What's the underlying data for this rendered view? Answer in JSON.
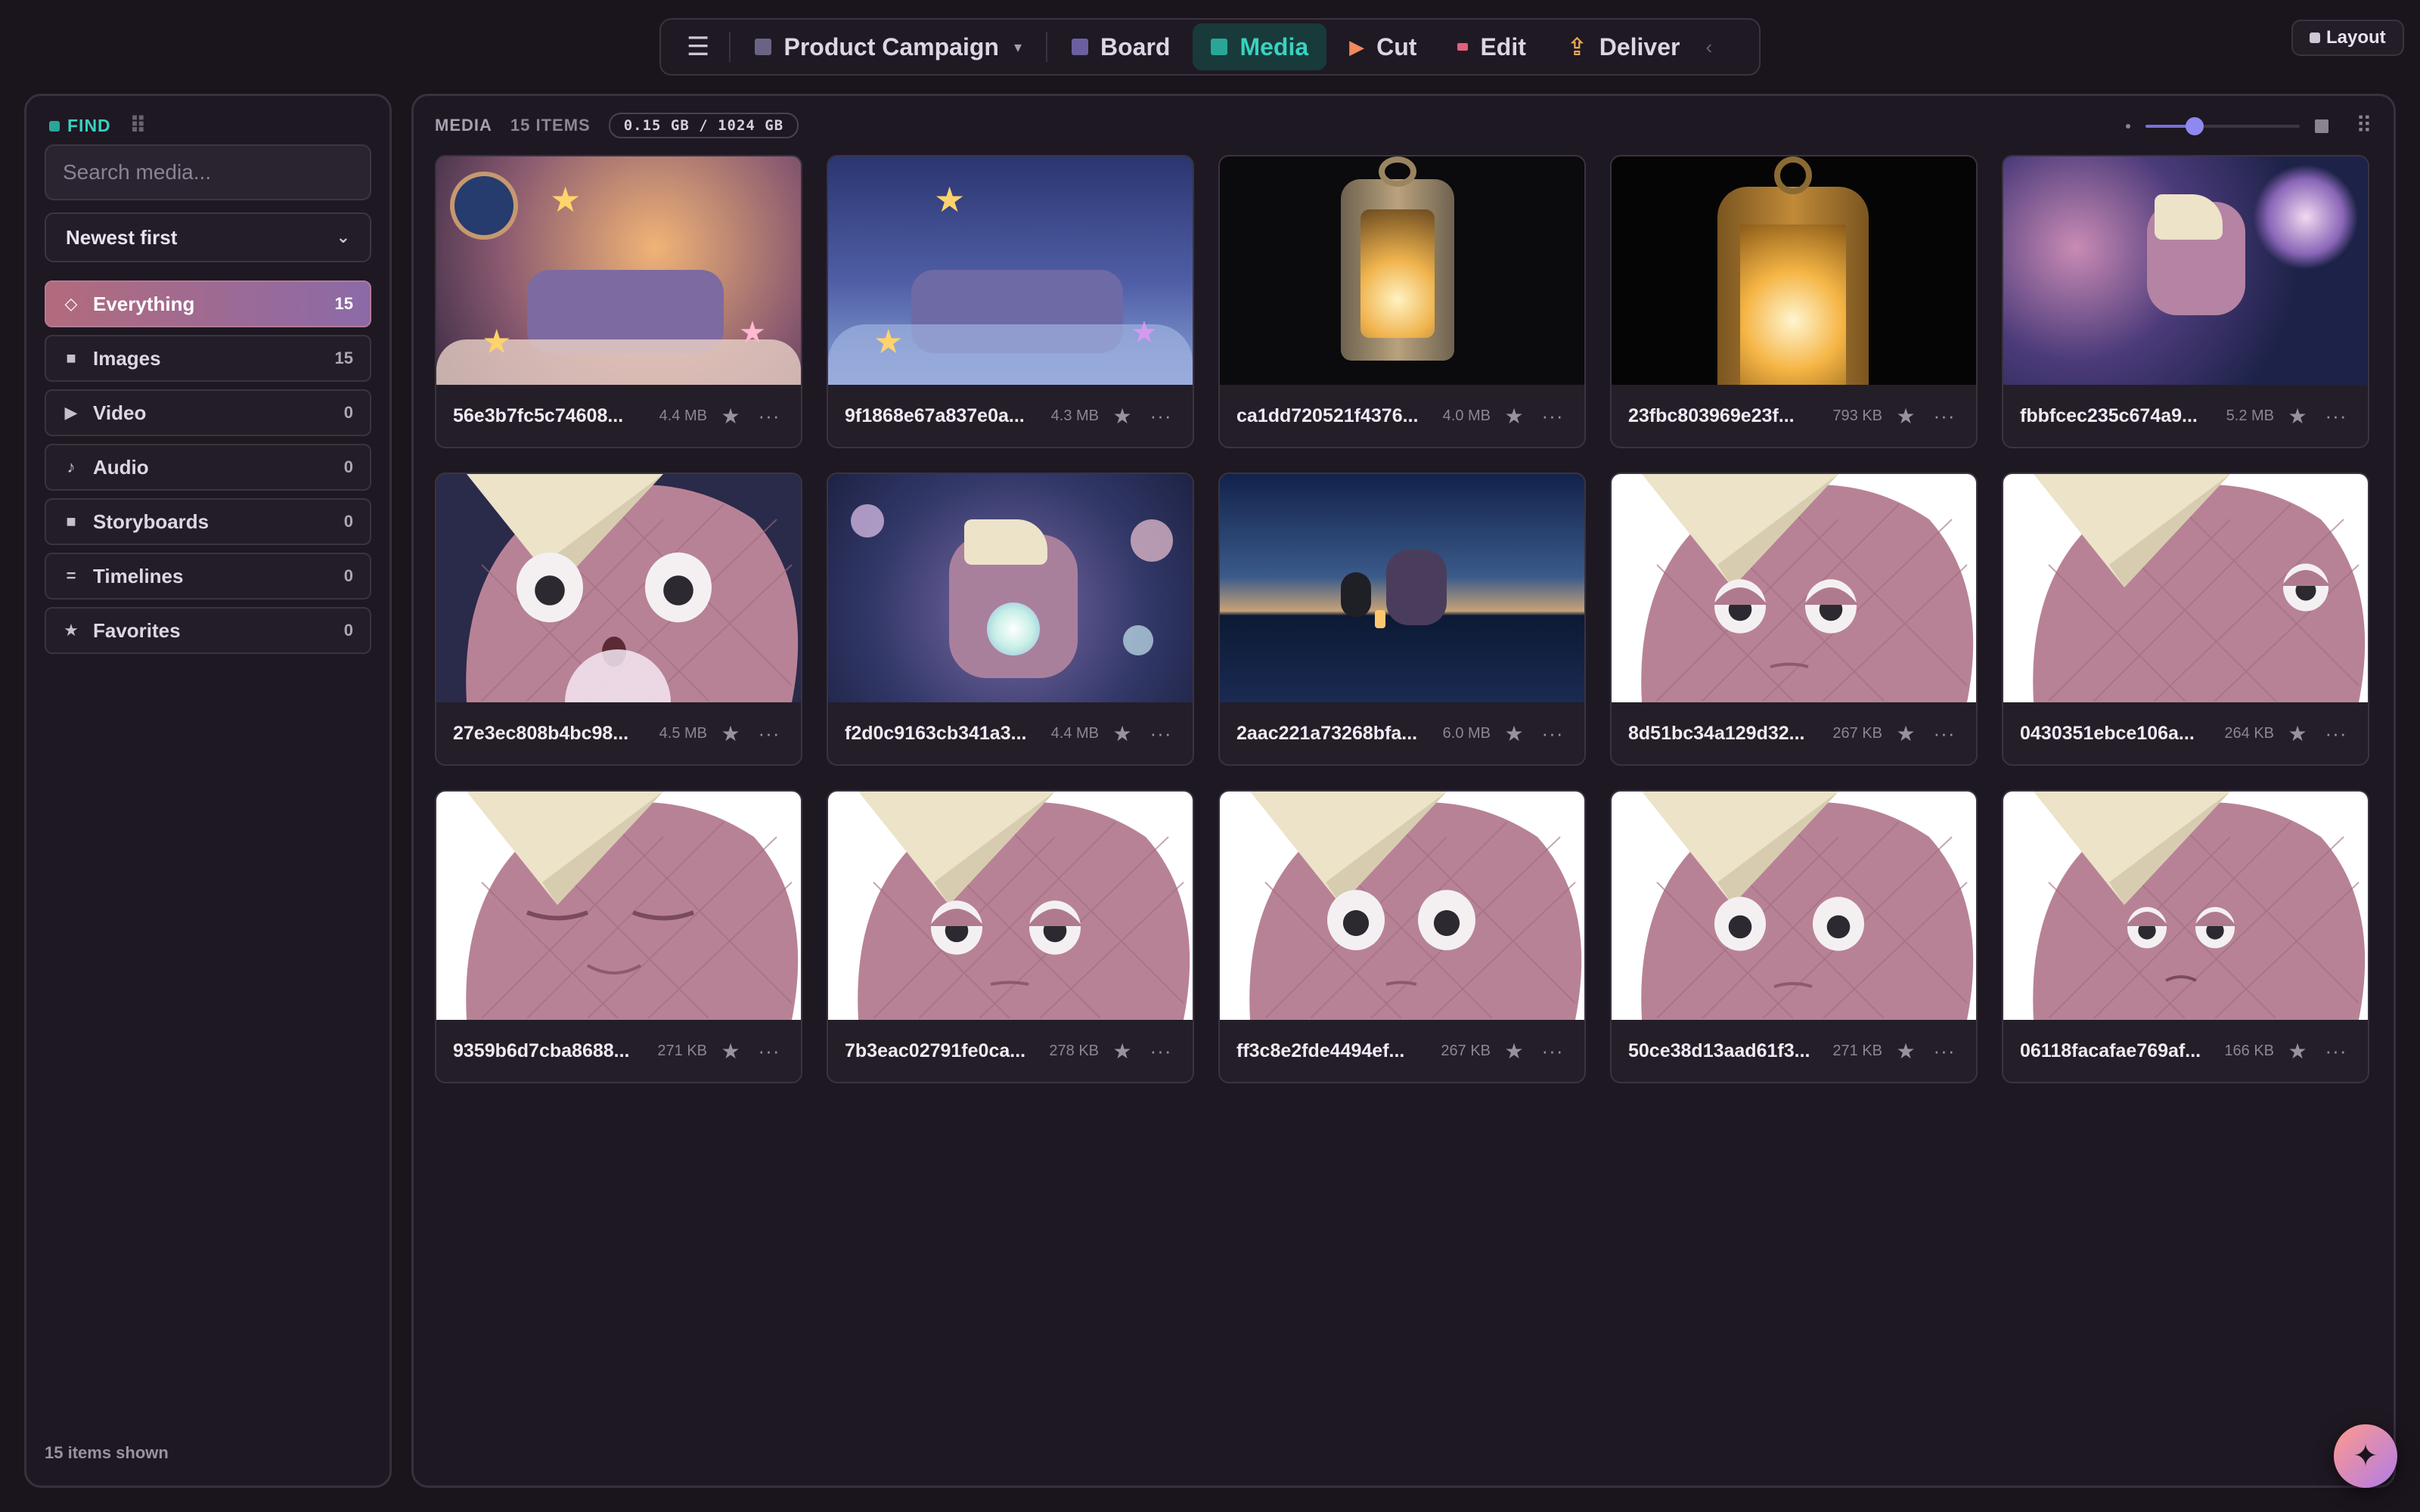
{
  "nav": {
    "project": "Product Campaign",
    "items": [
      {
        "label": "Board",
        "color": "#6b5fa0",
        "icon": "board-square-icon"
      },
      {
        "label": "Media",
        "color": "#2aa697",
        "icon": "media-square-icon",
        "active": true
      },
      {
        "label": "Cut",
        "color": "#f08a5d",
        "icon": "play-icon"
      },
      {
        "label": "Edit",
        "color": "#e0607e",
        "icon": "edit-dash-icon"
      },
      {
        "label": "Deliver",
        "color": "#e8a857",
        "icon": "deliver-arrow-icon"
      }
    ],
    "collapse": "‹"
  },
  "layout_button": "Layout",
  "sidebar": {
    "find_label": "FIND",
    "search_placeholder": "Search media...",
    "sort": "Newest first",
    "filters": [
      {
        "label": "Everything",
        "count": "15",
        "icon": "◇",
        "active": true
      },
      {
        "label": "Images",
        "count": "15",
        "icon": "■"
      },
      {
        "label": "Video",
        "count": "0",
        "icon": "▶"
      },
      {
        "label": "Audio",
        "count": "0",
        "icon": "♪"
      },
      {
        "label": "Storyboards",
        "count": "0",
        "icon": "■"
      },
      {
        "label": "Timelines",
        "count": "0",
        "icon": "="
      },
      {
        "label": "Favorites",
        "count": "0",
        "icon": "★"
      }
    ],
    "shown": "15 items shown"
  },
  "main": {
    "title": "MEDIA",
    "items": "15 ITEMS",
    "storage": "0.15 GB / 1024 GB",
    "zoom_level": 0.32
  },
  "media": [
    {
      "name": "56e3b7fc5c74608...",
      "size": "4.4 MB",
      "thumb": "bedroom-warm"
    },
    {
      "name": "9f1868e67a837e0a...",
      "size": "4.3 MB",
      "thumb": "bedroom-blue"
    },
    {
      "name": "ca1dd720521f4376...",
      "size": "4.0 MB",
      "thumb": "lantern-small"
    },
    {
      "name": "23fbc803969e23f...",
      "size": "793 KB",
      "thumb": "lantern-large"
    },
    {
      "name": "fbbfcec235c674a9...",
      "size": "5.2 MB",
      "thumb": "galaxy"
    },
    {
      "name": "27e3ec808b4bc98...",
      "size": "4.5 MB",
      "thumb": "pillow-surprised"
    },
    {
      "name": "f2d0c9163cb341a3...",
      "size": "4.4 MB",
      "thumb": "pillow-bubbles"
    },
    {
      "name": "2aac221a73268bfa...",
      "size": "6.0 MB",
      "thumb": "night-shore"
    },
    {
      "name": "8d51bc34a129d32...",
      "size": "267 KB",
      "thumb": "pillow-sleepy"
    },
    {
      "name": "0430351ebce106a...",
      "size": "264 KB",
      "thumb": "pillow-side"
    },
    {
      "name": "9359b6d7cba8688...",
      "size": "271 KB",
      "thumb": "pillow-eyes-closed"
    },
    {
      "name": "7b3eac02791fe0ca...",
      "size": "278 KB",
      "thumb": "pillow-tired"
    },
    {
      "name": "ff3c8e2fde4494ef...",
      "size": "267 KB",
      "thumb": "pillow-wide"
    },
    {
      "name": "50ce38d13aad61f3...",
      "size": "271 KB",
      "thumb": "pillow-worried"
    },
    {
      "name": "06118facafae769af...",
      "size": "166 KB",
      "thumb": "pillow-sad"
    }
  ]
}
